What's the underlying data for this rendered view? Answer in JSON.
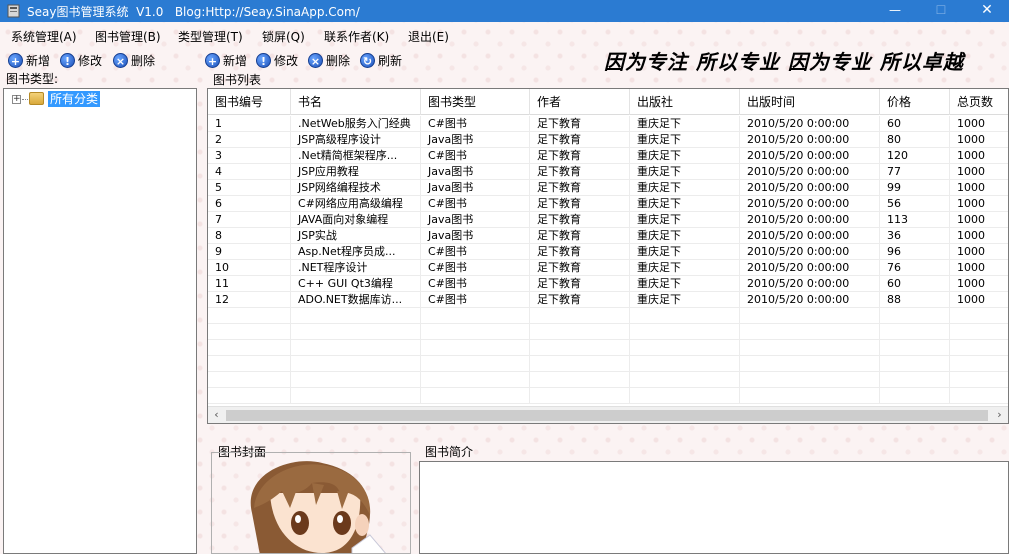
{
  "window": {
    "title": "Seay图书管理系统  V1.0   Blog:Http://Seay.SinaApp.Com/",
    "min_glyph": "—",
    "max_glyph": "☐",
    "close_glyph": "✕"
  },
  "menu": [
    "系统管理(A)",
    "图书管理(B)",
    "类型管理(T)",
    "锁屏(Q)",
    "联系作者(K)",
    "退出(E)"
  ],
  "left_toolbar": [
    {
      "label": "新增",
      "icon": "add-icon",
      "glyph": "+"
    },
    {
      "label": "修改",
      "icon": "edit-icon",
      "glyph": "!"
    },
    {
      "label": "删除",
      "icon": "delete-icon",
      "glyph": "×"
    }
  ],
  "right_toolbar": [
    {
      "label": "新增",
      "icon": "add-icon",
      "glyph": "+"
    },
    {
      "label": "修改",
      "icon": "edit-icon",
      "glyph": "!"
    },
    {
      "label": "删除",
      "icon": "delete-icon",
      "glyph": "×"
    },
    {
      "label": "刷新",
      "icon": "refresh-icon",
      "glyph": "↻"
    }
  ],
  "slogan": "因为专注 所以专业 因为专业 所以卓越",
  "tree": {
    "group_label": "图书类型:",
    "expander": "+",
    "root_label": "所有分类"
  },
  "grid": {
    "group_label": "图书列表",
    "columns": [
      "图书编号",
      "书名",
      "图书类型",
      "作者",
      "出版社",
      "出版时间",
      "价格",
      "总页数"
    ],
    "rows": [
      [
        "1",
        ".NetWeb服务入门经典",
        "C#图书",
        "足下教育",
        "重庆足下",
        "2010/5/20 0:00:00",
        "60",
        "1000"
      ],
      [
        "2",
        "JSP高级程序设计",
        "Java图书",
        "足下教育",
        "重庆足下",
        "2010/5/20 0:00:00",
        "80",
        "1000"
      ],
      [
        "3",
        ".Net精简框架程序...",
        "C#图书",
        "足下教育",
        "重庆足下",
        "2010/5/20 0:00:00",
        "120",
        "1000"
      ],
      [
        "4",
        "JSP应用教程",
        "Java图书",
        "足下教育",
        "重庆足下",
        "2010/5/20 0:00:00",
        "77",
        "1000"
      ],
      [
        "5",
        "JSP网络编程技术",
        "Java图书",
        "足下教育",
        "重庆足下",
        "2010/5/20 0:00:00",
        "99",
        "1000"
      ],
      [
        "6",
        "C#网络应用高级编程",
        "C#图书",
        "足下教育",
        "重庆足下",
        "2010/5/20 0:00:00",
        "56",
        "1000"
      ],
      [
        "7",
        "JAVA面向对象编程",
        "Java图书",
        "足下教育",
        "重庆足下",
        "2010/5/20 0:00:00",
        "113",
        "1000"
      ],
      [
        "8",
        "JSP实战",
        "Java图书",
        "足下教育",
        "重庆足下",
        "2010/5/20 0:00:00",
        "36",
        "1000"
      ],
      [
        "9",
        "Asp.Net程序员成...",
        "C#图书",
        "足下教育",
        "重庆足下",
        "2010/5/20 0:00:00",
        "96",
        "1000"
      ],
      [
        "10",
        ".NET程序设计",
        "C#图书",
        "足下教育",
        "重庆足下",
        "2010/5/20 0:00:00",
        "76",
        "1000"
      ],
      [
        "11",
        "C++ GUI Qt3编程",
        "C#图书",
        "足下教育",
        "重庆足下",
        "2010/5/20 0:00:00",
        "60",
        "1000"
      ],
      [
        "12",
        "ADO.NET数据库访...",
        "C#图书",
        "足下教育",
        "重庆足下",
        "2010/5/20 0:00:00",
        "88",
        "1000"
      ]
    ],
    "scroll_left": "‹",
    "scroll_right": "›"
  },
  "cover": {
    "group_label": "图书封面"
  },
  "description": {
    "group_label": "图书简介"
  }
}
